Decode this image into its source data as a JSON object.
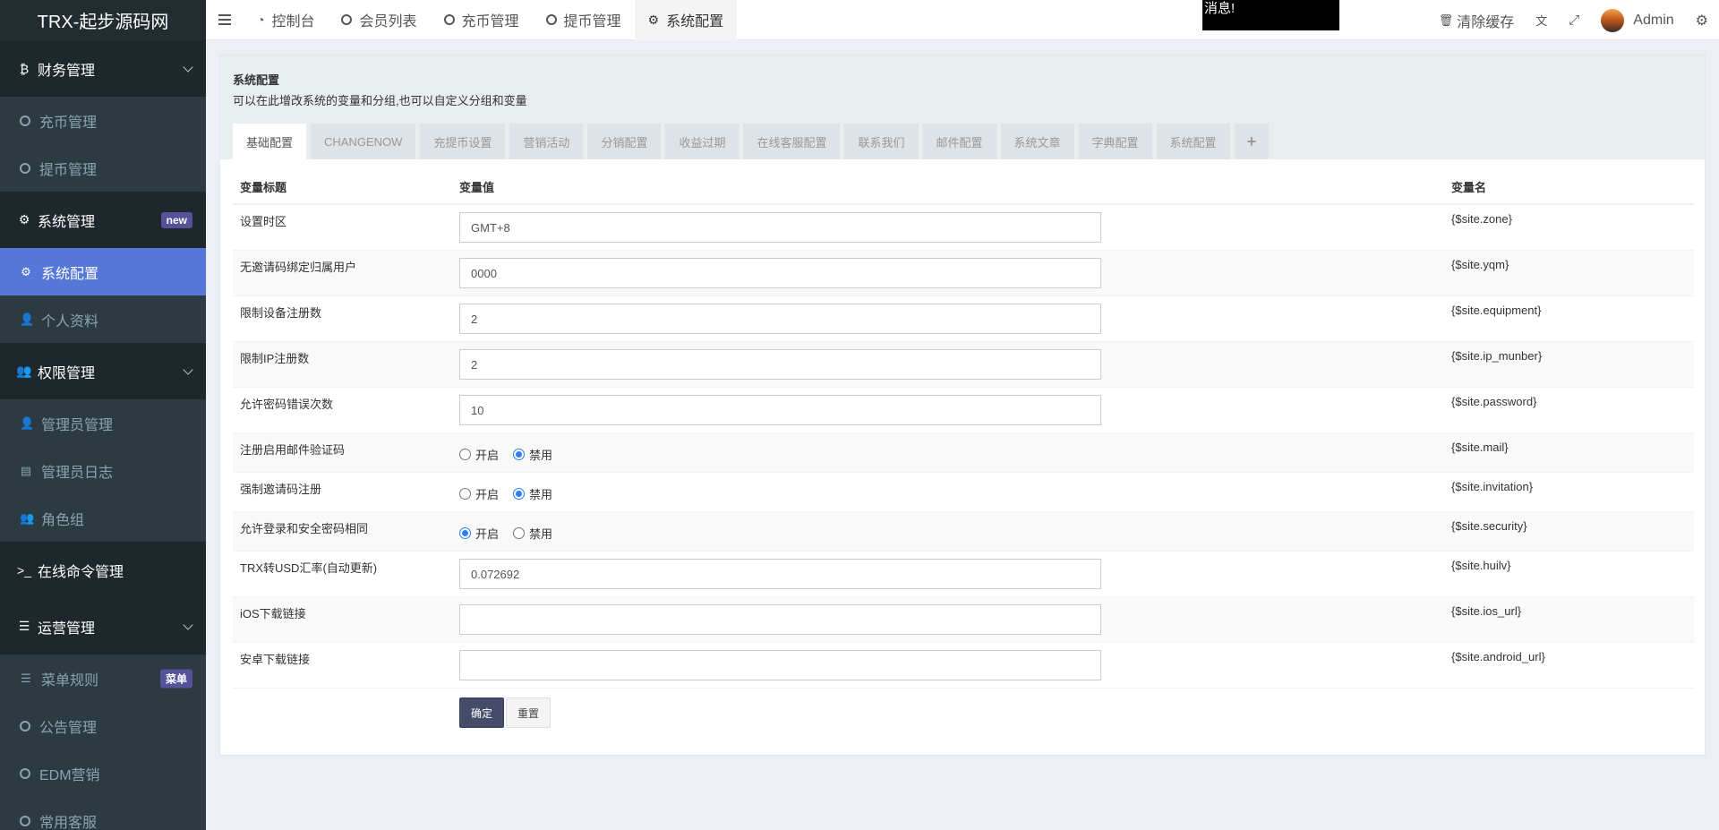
{
  "brand": "TRX-起步源码网",
  "sidebar": {
    "items": [
      {
        "type": "group",
        "icon": "bitcoin-icon",
        "glyph": "₿",
        "label": "财务管理",
        "chevron": true
      },
      {
        "type": "item",
        "icon": "circle-icon",
        "label": "充币管理"
      },
      {
        "type": "item",
        "icon": "circle-icon",
        "label": "提币管理"
      },
      {
        "type": "group",
        "icon": "cogs-icon",
        "glyph": "⚙",
        "label": "系统管理",
        "badge": "new"
      },
      {
        "type": "item",
        "icon": "gear-icon",
        "glyph": "⚙",
        "label": "系统配置",
        "active": true
      },
      {
        "type": "item",
        "icon": "user-icon",
        "glyph": "👤",
        "label": "个人资料"
      },
      {
        "type": "group",
        "icon": "users-icon",
        "glyph": "👥",
        "label": "权限管理",
        "chevron": true
      },
      {
        "type": "item",
        "icon": "user-icon",
        "glyph": "👤",
        "label": "管理员管理"
      },
      {
        "type": "item",
        "icon": "list-alt-icon",
        "glyph": "▤",
        "label": "管理员日志"
      },
      {
        "type": "item",
        "icon": "group-icon",
        "glyph": "👥",
        "label": "角色组"
      },
      {
        "type": "group",
        "icon": "terminal-icon",
        "glyph": ">_",
        "label": "在线命令管理"
      },
      {
        "type": "group",
        "icon": "list-icon",
        "glyph": "☰",
        "label": "运营管理",
        "chevron": true
      },
      {
        "type": "item",
        "icon": "bars-icon",
        "glyph": "☰",
        "label": "菜单规则",
        "badge": "菜单"
      },
      {
        "type": "item",
        "icon": "circle-icon",
        "label": "公告管理"
      },
      {
        "type": "item",
        "icon": "circle-icon",
        "label": "EDM营销"
      },
      {
        "type": "item",
        "icon": "circle-icon",
        "label": "常用客服"
      }
    ]
  },
  "header": {
    "tabs": [
      {
        "label": "控制台",
        "icon": "dashboard-icon",
        "glyph": "◔"
      },
      {
        "label": "会员列表",
        "icon": "circle-icon"
      },
      {
        "label": "充币管理",
        "icon": "circle-icon"
      },
      {
        "label": "提币管理",
        "icon": "circle-icon"
      },
      {
        "label": "系统配置",
        "icon": "gear-icon",
        "glyph": "⚙",
        "active": true
      }
    ],
    "message": "消息!",
    "clear_cache": "清除缓存",
    "user": "Admin"
  },
  "panel": {
    "title": "系统配置",
    "subtitle": "可以在此增改系统的变量和分组,也可以自定义分组和变量",
    "tabs": [
      "基础配置",
      "CHANGENOW",
      "充提币设置",
      "营销活动",
      "分销配置",
      "收益过期",
      "在线客服配置",
      "联系我们",
      "邮件配置",
      "系统文章",
      "字典配置",
      "系统配置"
    ],
    "plus": "+",
    "columns": [
      "变量标题",
      "变量值",
      "变量名"
    ],
    "rows": [
      {
        "title": "设置时区",
        "kind": "input",
        "value": "GMT+8",
        "name": "{$site.zone}"
      },
      {
        "title": "无邀请码绑定归属用户",
        "kind": "input",
        "value": "0000",
        "name": "{$site.yqm}"
      },
      {
        "title": "限制设备注册数",
        "kind": "input",
        "value": "2",
        "name": "{$site.equipment}"
      },
      {
        "title": "限制IP注册数",
        "kind": "input",
        "value": "2",
        "name": "{$site.ip_munber}"
      },
      {
        "title": "允许密码错误次数",
        "kind": "input",
        "value": "10",
        "name": "{$site.password}"
      },
      {
        "title": "注册启用邮件验证码",
        "kind": "radio",
        "options": [
          "开启",
          "禁用"
        ],
        "selected": 1,
        "name": "{$site.mail}"
      },
      {
        "title": "强制邀请码注册",
        "kind": "radio",
        "options": [
          "开启",
          "禁用"
        ],
        "selected": 1,
        "name": "{$site.invitation}"
      },
      {
        "title": "允许登录和安全密码相同",
        "kind": "radio",
        "options": [
          "开启",
          "禁用"
        ],
        "selected": 0,
        "name": "{$site.security}"
      },
      {
        "title": "TRX转USD汇率(自动更新)",
        "kind": "input",
        "value": "0.072692",
        "name": "{$site.huilv}"
      },
      {
        "title": "iOS下载链接",
        "kind": "input",
        "value": "",
        "name": "{$site.ios_url}"
      },
      {
        "title": "安卓下载链接",
        "kind": "input",
        "value": "",
        "name": "{$site.android_url}"
      }
    ],
    "submit_label": "确定",
    "reset_label": "重置"
  }
}
